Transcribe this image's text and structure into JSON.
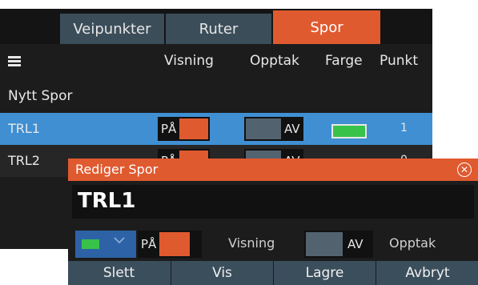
{
  "tabs": [
    {
      "label": "Veipunkter"
    },
    {
      "label": "Ruter"
    },
    {
      "label": "Spor",
      "active": true
    }
  ],
  "header": {
    "menu_icon": "hamburger-menu-icon",
    "col_visning": "Visning",
    "col_opptak": "Opptak",
    "col_farge": "Farge",
    "col_punkt": "Punkt"
  },
  "new_track_label": "Nytt Spor",
  "tracks": [
    {
      "name": "TRL1",
      "visning": "PÅ",
      "opptak": "AV",
      "color": "#38c24a",
      "points": "1",
      "selected": true
    },
    {
      "name": "TRL2",
      "visning": "PÅ",
      "opptak": "AV",
      "points": "0"
    }
  ],
  "dialog": {
    "title": "Rediger Spor",
    "name_value": "TRL1",
    "color": "#38c24a",
    "visning_state": "PÅ",
    "visning_label": "Visning",
    "opptak_state": "AV",
    "opptak_label": "Opptak",
    "buttons": {
      "delete": "Slett",
      "show": "Vis",
      "save": "Lagre",
      "cancel": "Avbryt"
    }
  },
  "colors": {
    "accent": "#e05a30",
    "selection": "#3f8fd2",
    "tab": "#3c4d5a",
    "track_color": "#38c24a"
  }
}
